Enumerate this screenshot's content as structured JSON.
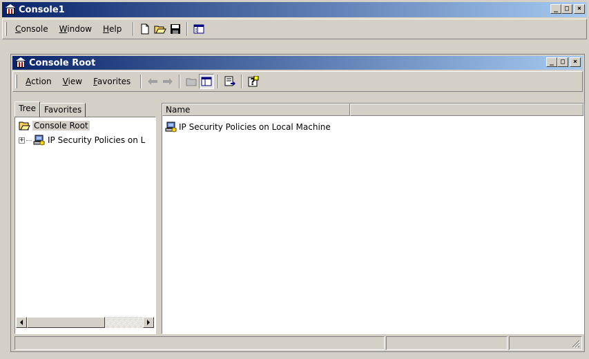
{
  "app": {
    "title": "Console1",
    "menu": [
      {
        "label": "Console",
        "accel": "C"
      },
      {
        "label": "Window",
        "accel": "W"
      },
      {
        "label": "Help",
        "accel": "H"
      }
    ],
    "toolbar_icons": [
      "new-document-icon",
      "open-folder-icon",
      "save-disk-icon",
      "show-hide-tree-icon"
    ]
  },
  "inner": {
    "title": "Console Root",
    "menu": [
      {
        "label": "Action",
        "accel": "A"
      },
      {
        "label": "View",
        "accel": "V"
      },
      {
        "label": "Favorites",
        "accel": "F"
      }
    ],
    "toolbar_icons": [
      "back-arrow-icon",
      "forward-arrow-icon",
      "up-folder-icon",
      "show-hide-tree-icon",
      "export-list-icon",
      "help-icon"
    ]
  },
  "tabs": [
    {
      "label": "Tree"
    },
    {
      "label": "Favorites"
    }
  ],
  "tree": {
    "root": "Console Root",
    "child": "IP Security Policies on L"
  },
  "list": {
    "columns": [
      "Name",
      ""
    ],
    "rows": [
      {
        "name": "IP Security Policies on Local Machine"
      }
    ]
  },
  "colors": {
    "title_gradient_start": "#0a246a",
    "title_gradient_end": "#a6caf0",
    "face": "#d4d0c8"
  }
}
